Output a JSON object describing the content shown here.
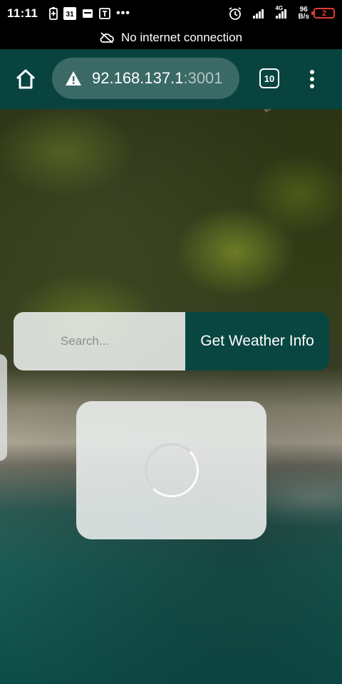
{
  "status_bar": {
    "time": "11:11",
    "calendar_day": "31",
    "more": "•••",
    "network_type": "4G",
    "speed_value": "96",
    "speed_unit": "B/s",
    "battery_level": "2"
  },
  "connection_banner": {
    "text": "No internet connection",
    "icon": "cloud-off-icon"
  },
  "browser": {
    "url_host": "92.168.137.1",
    "url_port": ":3001",
    "tab_count": "10",
    "icons": [
      "home-icon",
      "warning-icon",
      "tabs-icon",
      "more-vert-icon"
    ]
  },
  "page": {
    "search": {
      "placeholder": "Search...",
      "value": ""
    },
    "button_label": "Get Weather Info",
    "loading": true
  },
  "colors": {
    "toolbar": "#08433f",
    "button": "#0a4641",
    "battery_low": "#e53935"
  }
}
